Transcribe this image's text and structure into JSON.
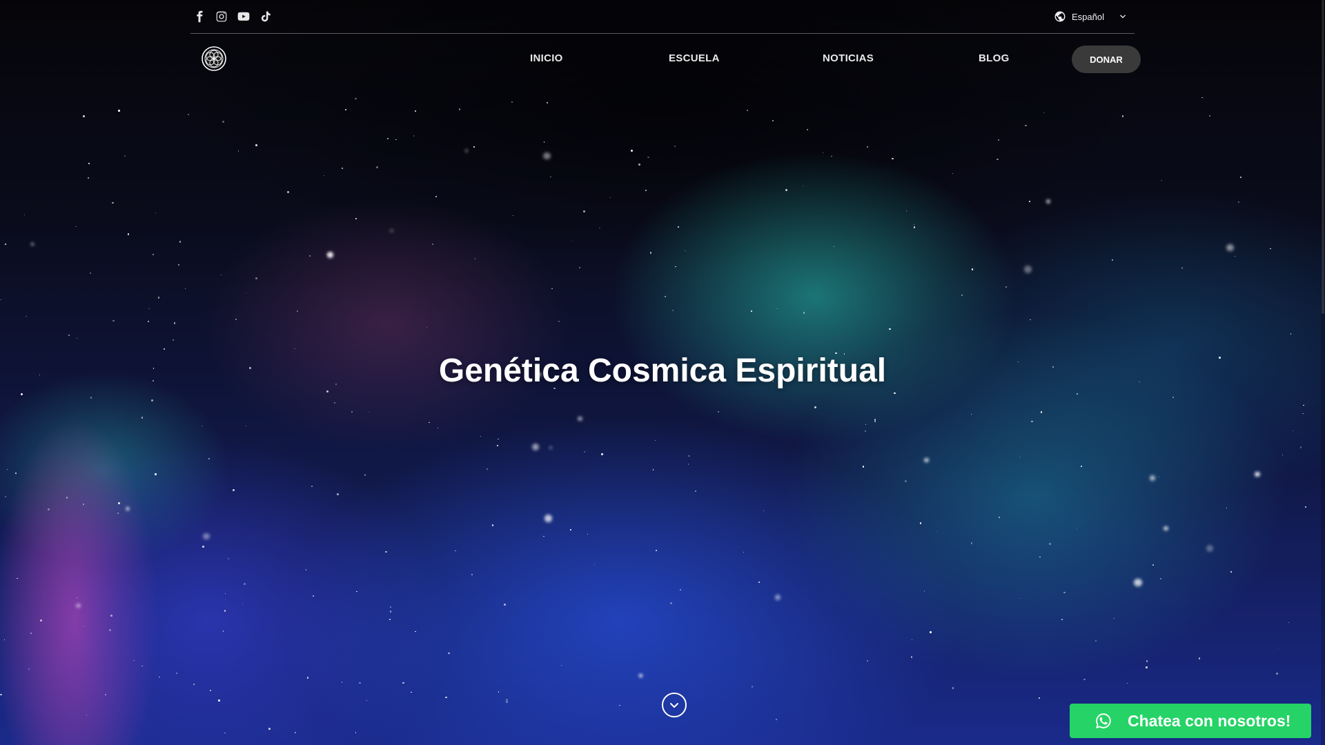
{
  "social": [
    {
      "name": "facebook-icon"
    },
    {
      "name": "instagram-icon"
    },
    {
      "name": "youtube-icon"
    },
    {
      "name": "tiktok-icon"
    }
  ],
  "language": {
    "label": "Español",
    "icon": "globe-icon"
  },
  "nav": {
    "logo_icon": "flower-of-life-icon",
    "items": [
      {
        "label": "INICIO"
      },
      {
        "label": "ESCUELA"
      },
      {
        "label": "NOTICIAS"
      },
      {
        "label": "BLOG"
      }
    ],
    "donate_label": "DONAR"
  },
  "hero": {
    "title": "Genética Cosmica Espiritual",
    "scroll_icon": "chevron-down-circle-icon"
  },
  "chat": {
    "label": "Chatea con nosotros!",
    "icon": "whatsapp-icon",
    "color": "#25d366"
  },
  "colors": {
    "donate_bg": "#3a3a3a",
    "topbar_divider": "rgba(255,255,255,0.35)"
  }
}
